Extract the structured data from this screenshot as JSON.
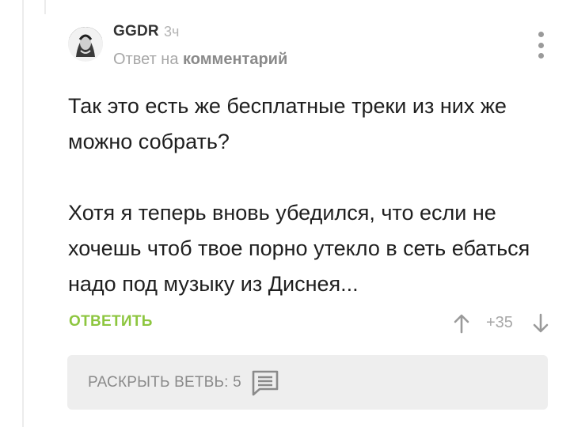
{
  "comment": {
    "author": "GGDR",
    "time": "3ч",
    "reply_prefix": "Ответ на",
    "reply_link": "комментарий",
    "paragraphs": [
      "Так это есть же бесплатные треки из них же можно собрать?",
      "Хотя я теперь вновь убедился, что если не хочешь чтоб твое порно утекло в сеть ебаться надо под музыку из Диснея..."
    ],
    "reply_label": "ОТВЕТИТЬ",
    "rating": "+35",
    "expand_label": "РАСКРЫТЬ ВЕТВЬ: 5"
  },
  "icons": {
    "menu": "more-vertical-icon",
    "upvote": "arrow-up-icon",
    "downvote": "arrow-down-icon",
    "expand": "comment-icon"
  },
  "colors": {
    "accent": "#8dc63f",
    "muted": "#a7a7a7",
    "panel": "#eeeeee"
  }
}
